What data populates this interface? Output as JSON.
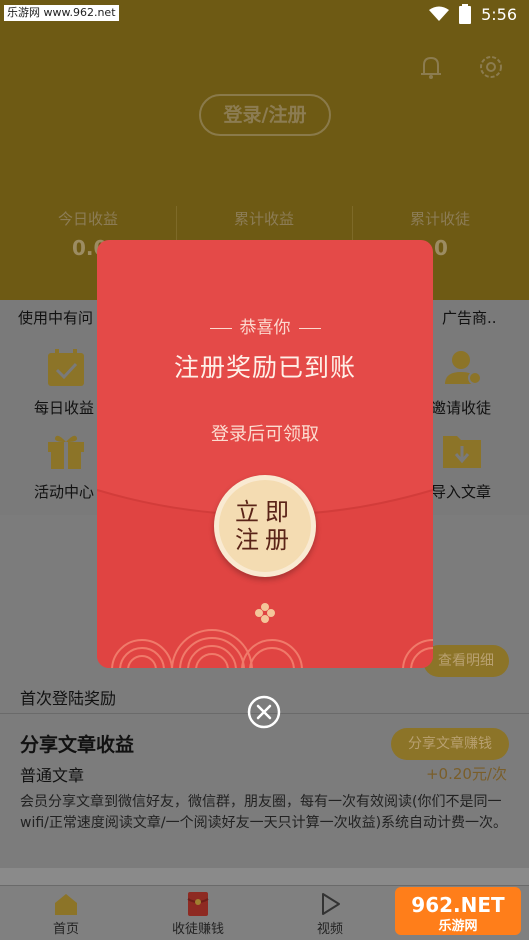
{
  "status_bar": {
    "watermark": "乐游网 www.962.net",
    "time": "5:56"
  },
  "header": {
    "login_label": "登录/注册",
    "stats": [
      {
        "label": "今日收益",
        "value": "0.0"
      },
      {
        "label": "累计收益",
        "value": ""
      },
      {
        "label": "累计收徒",
        "value": "0"
      }
    ]
  },
  "notice": {
    "left": "使用中有问",
    "right": "广告商.."
  },
  "grid": [
    {
      "label": "每日收益",
      "icon": "calendar-check-icon"
    },
    {
      "label": "邀请收徒",
      "icon": "add-user-icon"
    },
    {
      "label": "活动中心",
      "icon": "gift-icon"
    },
    {
      "label": "导入文章",
      "icon": "folder-download-icon"
    }
  ],
  "tasks": {
    "detail_button": "查看明细",
    "first_login": "首次登陆奖励",
    "share_title": "分享文章收益",
    "share_sub": "普通文章",
    "share_button": "分享文章赚钱",
    "share_price": "+0.20元/次",
    "share_desc": "会员分享文章到微信好友，微信群，朋友圈，每有一次有效阅读(你们不是同一wifi/正常速度阅读文章/一个阅读好友一天只计算一次收益)系统自动计费一次。"
  },
  "nav": [
    {
      "label": "首页",
      "icon": "home-icon"
    },
    {
      "label": "收徒赚钱",
      "icon": "red-envelope-icon"
    },
    {
      "label": "视频",
      "icon": "play-icon"
    },
    {
      "label": "",
      "icon": "profile-icon"
    }
  ],
  "popup": {
    "congrats": "恭喜你",
    "title": "注册奖励已到账",
    "subtitle": "登录后可领取",
    "button_line1": "立即",
    "button_line2": "注册"
  },
  "watermark_bottom": "962.NET 乐游网",
  "colors": {
    "header_bg": "#6e5a14",
    "popup_red": "#e44a48",
    "button_gold": "#f4dcb2"
  }
}
